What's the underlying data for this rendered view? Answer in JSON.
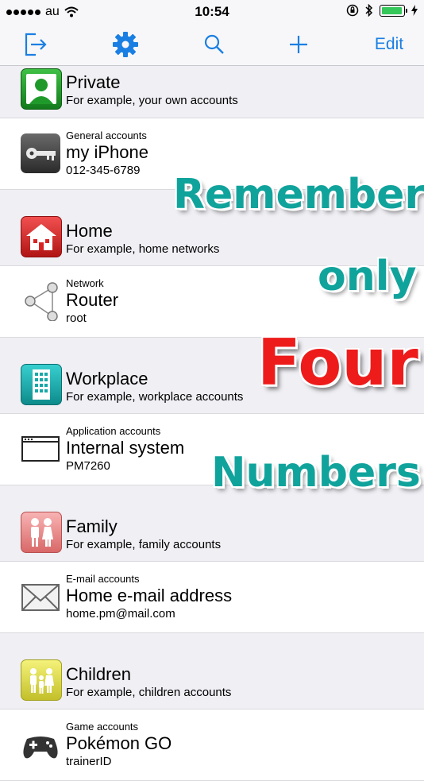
{
  "status": {
    "carrier": "au",
    "time": "10:54"
  },
  "toolbar": {
    "edit_label": "Edit"
  },
  "rows": [
    {
      "kind": "group",
      "title": "Private",
      "subtitle": "For example, your own accounts",
      "icon": "person-icon",
      "color": "#1f9a2a"
    },
    {
      "kind": "item",
      "category": "General accounts",
      "title": "my iPhone",
      "detail": "012-345-6789",
      "icon": "key-icon"
    },
    {
      "kind": "group",
      "title": "Home",
      "subtitle": "For example, home networks",
      "icon": "house-icon",
      "color": "#d92323"
    },
    {
      "kind": "item",
      "category": "Network",
      "title": "Router",
      "detail": "root",
      "icon": "network-icon"
    },
    {
      "kind": "group",
      "title": "Workplace",
      "subtitle": "For example, workplace accounts",
      "icon": "building-icon",
      "color": "#16a8a8"
    },
    {
      "kind": "item",
      "category": "Application accounts",
      "title": "Internal system",
      "detail": "PM7260",
      "icon": "window-icon"
    },
    {
      "kind": "group",
      "title": "Family",
      "subtitle": "For example, family accounts",
      "icon": "family-icon",
      "color": "#ef8d8d"
    },
    {
      "kind": "item",
      "category": "E-mail accounts",
      "title": "Home e-mail address",
      "detail": "home.pm@mail.com",
      "icon": "envelope-icon"
    },
    {
      "kind": "group",
      "title": "Children",
      "subtitle": "For example, children accounts",
      "icon": "children-icon",
      "color": "#e2e04a"
    },
    {
      "kind": "item",
      "category": "Game accounts",
      "title": "Pokémon GO",
      "detail": "trainerID",
      "icon": "gamepad-icon"
    }
  ],
  "overlay": {
    "line1": "Remember",
    "line2": "only",
    "line3": "Four",
    "line4": "Numbers"
  }
}
